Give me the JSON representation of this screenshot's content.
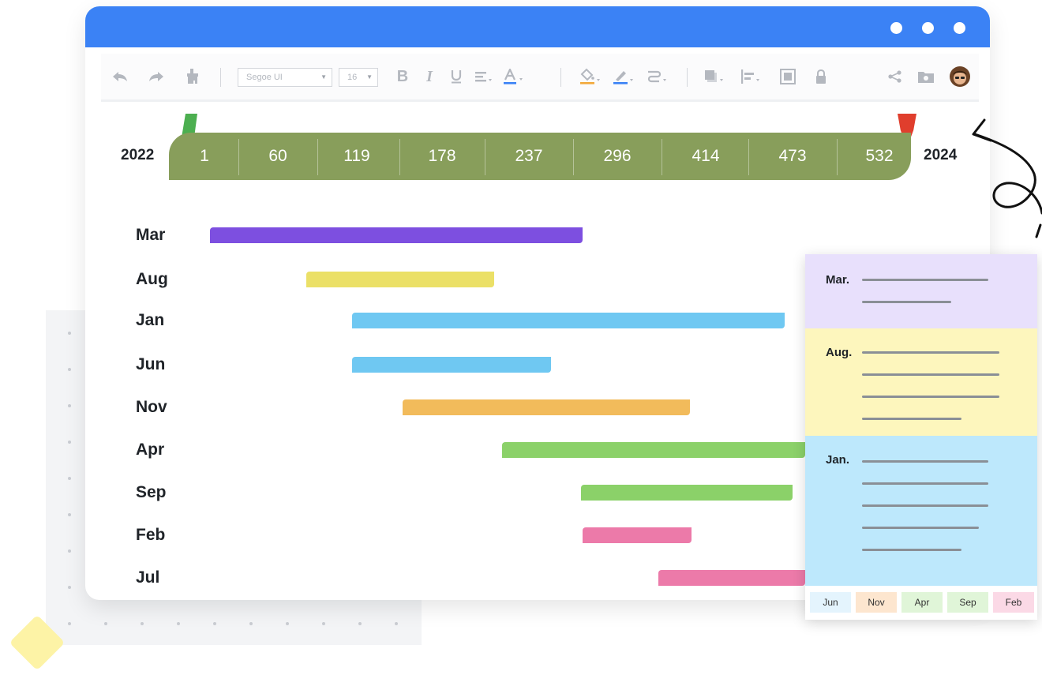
{
  "toolbar": {
    "font_family": "Segoe UI",
    "font_size": "16",
    "icons": [
      "undo-icon",
      "redo-icon",
      "format-painter-icon",
      "bold-icon",
      "italic-icon",
      "underline-icon",
      "align-icon",
      "font-color-icon",
      "fill-color-icon",
      "line-color-icon",
      "connector-icon",
      "shadow-icon",
      "distribute-icon",
      "group-icon",
      "lock-icon",
      "share-icon",
      "folder-icon",
      "avatar"
    ]
  },
  "timeline": {
    "start_year": "2022",
    "end_year": "2024",
    "labels": [
      "1",
      "60",
      "119",
      "178",
      "237",
      "296",
      "414",
      "473",
      "532"
    ],
    "fill_color": "#889e5b",
    "start_flag_color": "#4caf50",
    "end_flag_color": "#e03e2d"
  },
  "gantt": {
    "rows": [
      {
        "label": "Mar",
        "color": "#7d4fe0"
      },
      {
        "label": "Aug",
        "color": "#ebe067"
      },
      {
        "label": "Jan",
        "color": "#6fc8f2"
      },
      {
        "label": "Jun",
        "color": "#6fc8f2"
      },
      {
        "label": "Nov",
        "color": "#f2bb5b"
      },
      {
        "label": "Apr",
        "color": "#8bd169"
      },
      {
        "label": "Sep",
        "color": "#8bd169"
      },
      {
        "label": "Feb",
        "color": "#ec7aa9"
      },
      {
        "label": "Jul",
        "color": "#ec7aa9"
      }
    ]
  },
  "notes": {
    "sections": [
      {
        "title": "Mar.",
        "color": "#e8e0fc"
      },
      {
        "title": "Aug.",
        "color": "#fdf6bd"
      },
      {
        "title": "Jan.",
        "color": "#bde8fc"
      }
    ],
    "chips": [
      {
        "label": "Jun",
        "color": "#e4f4fd"
      },
      {
        "label": "Nov",
        "color": "#fde6cf"
      },
      {
        "label": "Apr",
        "color": "#e0f5d8"
      },
      {
        "label": "Sep",
        "color": "#e0f5d8"
      },
      {
        "label": "Feb",
        "color": "#fbd9e6"
      }
    ]
  }
}
